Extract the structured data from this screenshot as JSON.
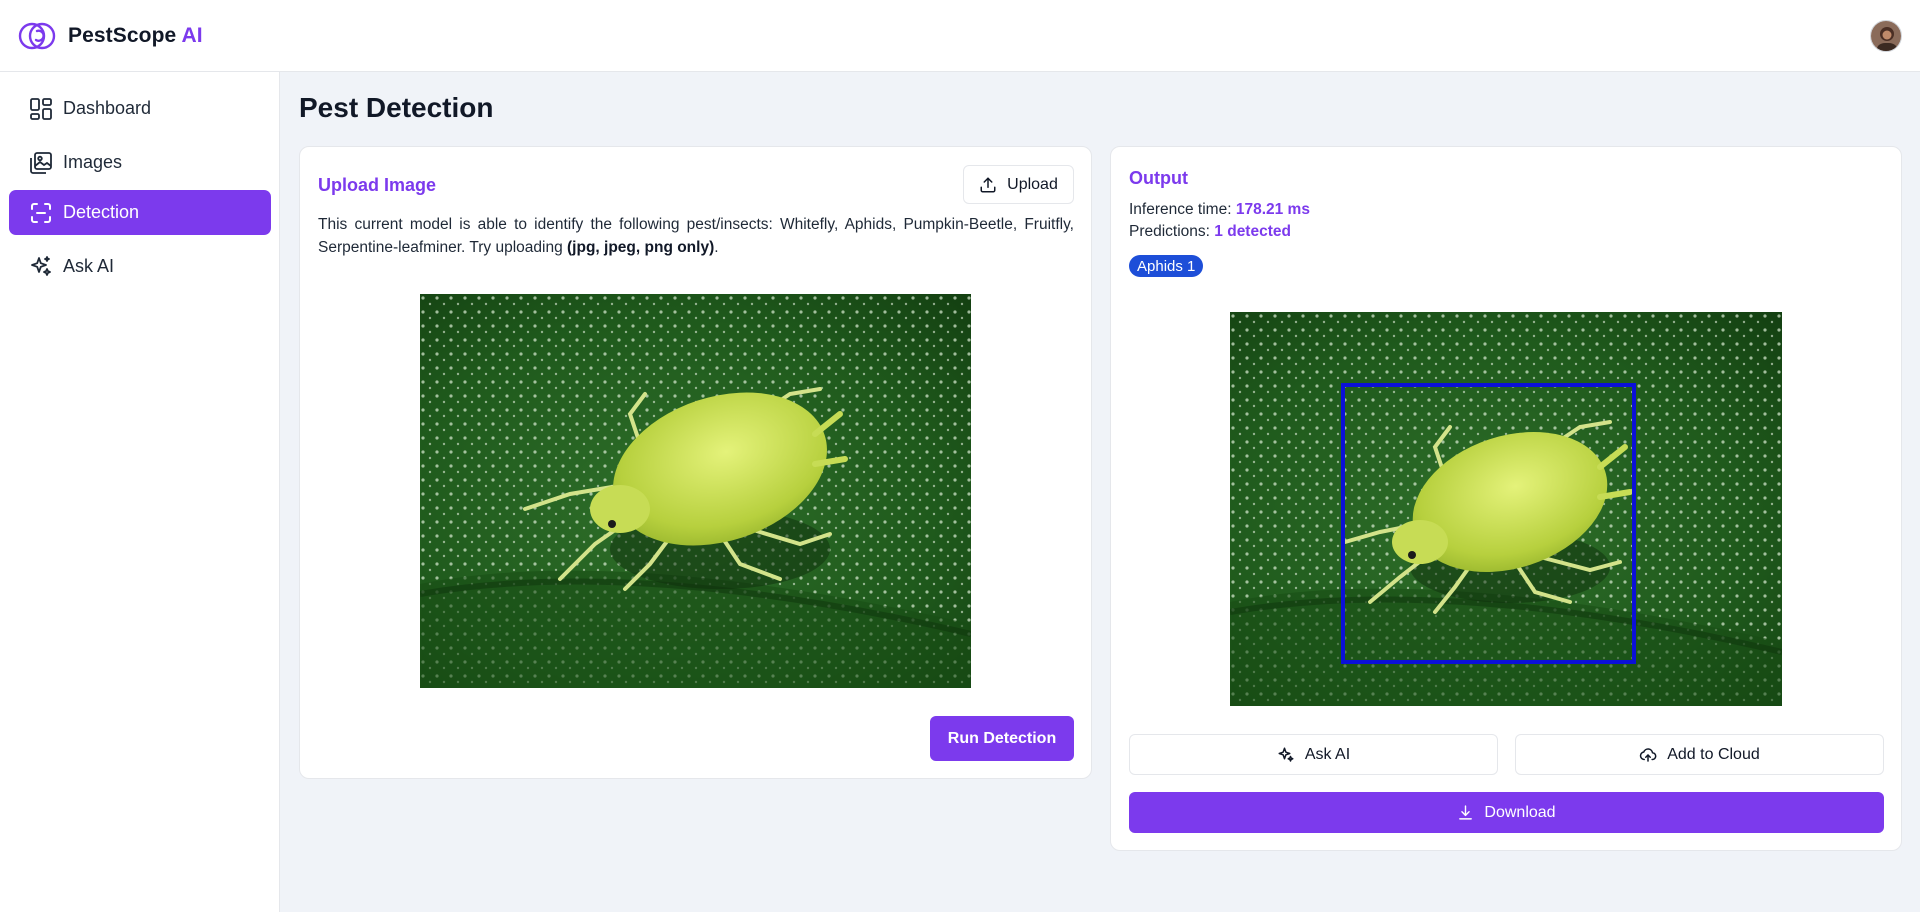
{
  "app": {
    "brand_name": "PestScope",
    "brand_ai": "AI",
    "accent_color": "#7c3aed"
  },
  "sidebar": {
    "items": [
      {
        "label": "Dashboard",
        "icon": "dashboard-icon",
        "active": false
      },
      {
        "label": "Images",
        "icon": "images-icon",
        "active": false
      },
      {
        "label": "Detection",
        "icon": "scan-icon",
        "active": true
      },
      {
        "label": "Ask AI",
        "icon": "sparkles-icon",
        "active": false
      }
    ]
  },
  "page": {
    "title": "Pest Detection"
  },
  "upload_card": {
    "title": "Upload Image",
    "upload_label": "Upload",
    "description": "This current model is able to identify the following pest/insects: Whitefly, Aphids, Pumpkin-Beetle, Fruitfly, Serpentine-leafminer. Try uploading",
    "formats": "(jpg, jpeg, png only)",
    "description_end": ".",
    "run_label": "Run Detection"
  },
  "output_card": {
    "title": "Output",
    "inference_label": "Inference time:",
    "inference_value": "178.21 ms",
    "predictions_label": "Predictions:",
    "predictions_value": "1 detected",
    "badge": "Aphids 1",
    "ask_ai_label": "Ask AI",
    "cloud_label": "Add to Cloud",
    "download_label": "Download"
  }
}
